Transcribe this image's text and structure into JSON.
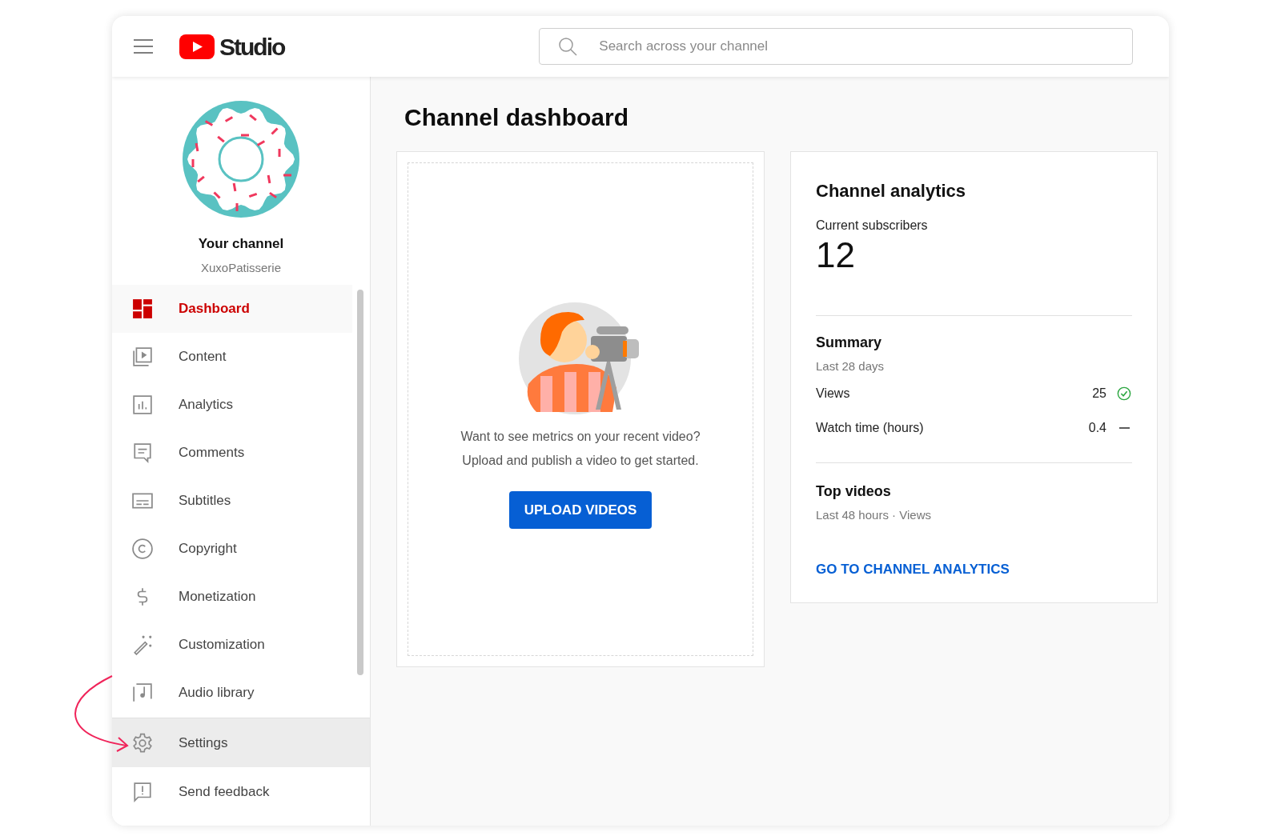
{
  "header": {
    "logo_text": "Studio",
    "search": {
      "placeholder": "Search across your channel"
    }
  },
  "channel": {
    "name": "Your channel",
    "handle": "XuxoPatisserie"
  },
  "nav": [
    {
      "label": "Dashboard",
      "selected": true
    },
    {
      "label": "Content",
      "selected": false
    },
    {
      "label": "Analytics",
      "selected": false
    },
    {
      "label": "Comments",
      "selected": false
    },
    {
      "label": "Subtitles",
      "selected": false
    },
    {
      "label": "Copyright",
      "selected": false
    },
    {
      "label": "Monetization",
      "selected": false
    },
    {
      "label": "Customization",
      "selected": false
    },
    {
      "label": "Audio library",
      "selected": false
    }
  ],
  "footer_nav": [
    {
      "label": "Settings",
      "highlighted": true
    },
    {
      "label": "Send feedback",
      "highlighted": false
    }
  ],
  "main": {
    "title": "Channel dashboard",
    "upload_card": {
      "message_lines": [
        "Want to see metrics on your recent video?",
        "Upload and publish a video to get started."
      ],
      "button": "UPLOAD VIDEOS"
    },
    "analytics_card": {
      "title": "Channel analytics",
      "subscribers_label": "Current subscribers",
      "subscribers": "12",
      "summary_title": "Summary",
      "summary_period": "Last 28 days",
      "metrics": [
        {
          "label": "Views",
          "value": "25",
          "kind": "up"
        },
        {
          "label": "Watch time (hours)",
          "value": "0.4",
          "kind": "flat"
        }
      ],
      "top_videos_title": "Top videos",
      "top_videos_subtitle": "Last 48 hours · Views",
      "link": "GO TO CHANNEL ANALYTICS"
    }
  }
}
